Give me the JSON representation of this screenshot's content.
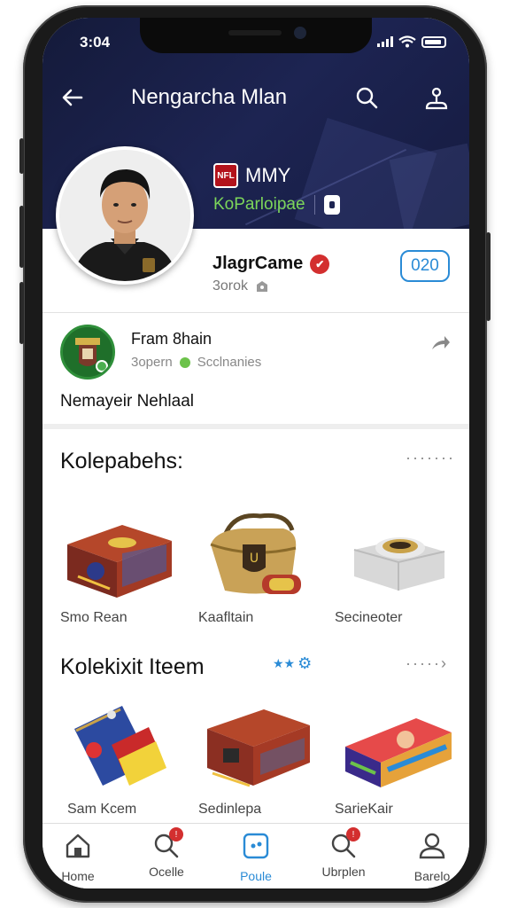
{
  "status": {
    "time": "3:04"
  },
  "header": {
    "title": "Nengarcha Mlan"
  },
  "brand": {
    "name": "MMY",
    "subtitle": "KoParloipae"
  },
  "profile": {
    "name": "JlagrCame",
    "subtitle": "3orok",
    "level": "020"
  },
  "team": {
    "name": "Fram 8hain",
    "meta_left": "3opern",
    "meta_right": "Scclnanies",
    "description": "Nemayeir Nehlaal"
  },
  "collections": {
    "title": "Kolepabehs:",
    "more": "·······",
    "items": [
      {
        "label": "Smo Rean"
      },
      {
        "label": "Kaafltain"
      },
      {
        "label": "Secineoter"
      }
    ]
  },
  "collection_items": {
    "title": "Kolekixit Iteem",
    "more": "·····›",
    "items": [
      {
        "label": "Sam Kcem"
      },
      {
        "label": "Sedinlepa"
      },
      {
        "label": "SarieKair"
      }
    ]
  },
  "tabbar": {
    "tabs": [
      {
        "label": "Home",
        "icon": "home-icon"
      },
      {
        "label": "Ocelle",
        "icon": "search-icon",
        "badge": "!"
      },
      {
        "label": "Poule",
        "icon": "profile-card-icon",
        "active": true
      },
      {
        "label": "Ubrplen",
        "icon": "search-icon",
        "badge": "!"
      },
      {
        "label": "Barelo",
        "icon": "user-icon"
      }
    ]
  },
  "colors": {
    "header_bg": "#1d2452",
    "accent": "#2a8bd6",
    "verified": "#d32f2f",
    "brand_green": "#7cd65a"
  }
}
